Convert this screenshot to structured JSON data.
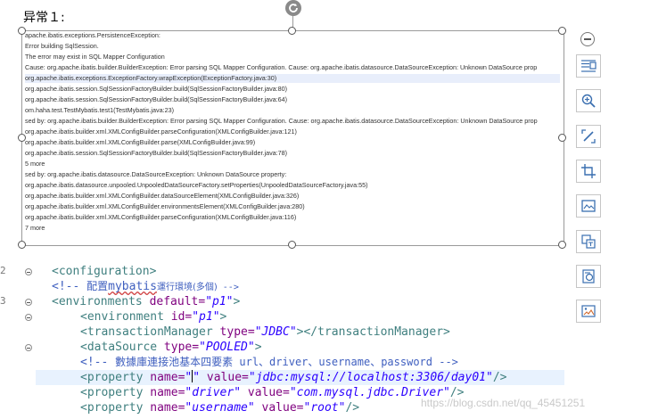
{
  "heading": "异常１:",
  "stack_trace": [
    "apache.ibatis.exceptions.PersistenceException:",
    " Error building SqlSession.",
    " The error may exist in SQL Mapper Configuration",
    " Cause: org.apache.ibatis.builder.BuilderException: Error parsing SQL Mapper Configuration. Cause: org.apache.ibatis.datasource.DataSourceException: Unknown DataSource prop",
    "org.apache.ibatis.exceptions.ExceptionFactory.wrapException(ExceptionFactory.java:30)",
    "org.apache.ibatis.session.SqlSessionFactoryBuilder.build(SqlSessionFactoryBuilder.java:80)",
    "org.apache.ibatis.session.SqlSessionFactoryBuilder.build(SqlSessionFactoryBuilder.java:64)",
    "om.haha.test.TestMybatis.test1(TestMybatis.java:23)",
    "sed by: org.apache.ibatis.builder.BuilderException: Error parsing SQL Mapper Configuration. Cause: org.apache.ibatis.datasource.DataSourceException: Unknown DataSource prop",
    "org.apache.ibatis.builder.xml.XMLConfigBuilder.parseConfiguration(XMLConfigBuilder.java:121)",
    "org.apache.ibatis.builder.xml.XMLConfigBuilder.parse(XMLConfigBuilder.java:99)",
    "org.apache.ibatis.session.SqlSessionFactoryBuilder.build(SqlSessionFactoryBuilder.java:78)",
    "5 more",
    "sed by: org.apache.ibatis.datasource.DataSourceException: Unknown DataSource property:",
    "org.apache.ibatis.datasource.unpooled.UnpooledDataSourceFactory.setProperties(UnpooledDataSourceFactory.java:55)",
    "org.apache.ibatis.builder.xml.XMLConfigBuilder.dataSourceElement(XMLConfigBuilder.java:326)",
    "org.apache.ibatis.builder.xml.XMLConfigBuilder.environmentsElement(XMLConfigBuilder.java:280)",
    "org.apache.ibatis.builder.xml.XMLConfigBuilder.parseConfiguration(XMLConfigBuilder.java:116)",
    "7 more"
  ],
  "code": {
    "line_numbers": [
      "2",
      "",
      "3",
      "",
      "",
      "",
      "",
      "",
      "",
      "",
      ""
    ],
    "l1_tag": "<configuration>",
    "l2_open": "<!-- ",
    "l2_cjk_a": "配置",
    "l2_word": "mybatis",
    "l2_cjk_b": "運行環境(多個)",
    "l2_close": " -->",
    "l3_tag": "<environments ",
    "l3_attr": "default=",
    "l3_val": "\"p1\"",
    "l3_end": ">",
    "l4_tag": "<environment ",
    "l4_attr": "id=",
    "l4_val": "\"p1\"",
    "l4_end": ">",
    "l5_tag": "<transactionManager ",
    "l5_attr": "type=",
    "l5_val": "\"JDBC\"",
    "l5_end": "></transactionManager>",
    "l6_tag": "<dataSource ",
    "l6_attr": "type=",
    "l6_val": "\"POOLED\"",
    "l6_end": ">",
    "l7_open": "<!-- ",
    "l7_cjk": "數據庫連接池基本四要素",
    "l7_rest": " url、driver、username、password -->",
    "l8_tag": "<property ",
    "l8_attr1": "name=",
    "l8_val1_a": "\"",
    "l8_val1_b": "\"",
    "l8_attr2": " value=",
    "l8_val2": "\"jdbc:mysql://localhost:3306/day01\"",
    "l8_end": "/>",
    "l9_tag": "<property ",
    "l9_attr1": "name=",
    "l9_val1": "\"driver\"",
    "l9_attr2": " value=",
    "l9_val2": "\"com.mysql.jdbc.Driver\"",
    "l9_end": "/>",
    "l10_tag": "<property ",
    "l10_attr1": "name=",
    "l10_val1": "\"username\"",
    "l10_attr2": " value=",
    "l10_val2": "\"root\"",
    "l10_end": "/>"
  },
  "watermark": "https://blog.csdn.net/qq_45451251",
  "toolbar_icons": [
    "layout-options-icon",
    "zoom-icon",
    "crop-edit-icon",
    "crop-icon",
    "image-preview-icon",
    "image-to-text-icon",
    "image-translate-icon",
    "image-edit-icon"
  ]
}
